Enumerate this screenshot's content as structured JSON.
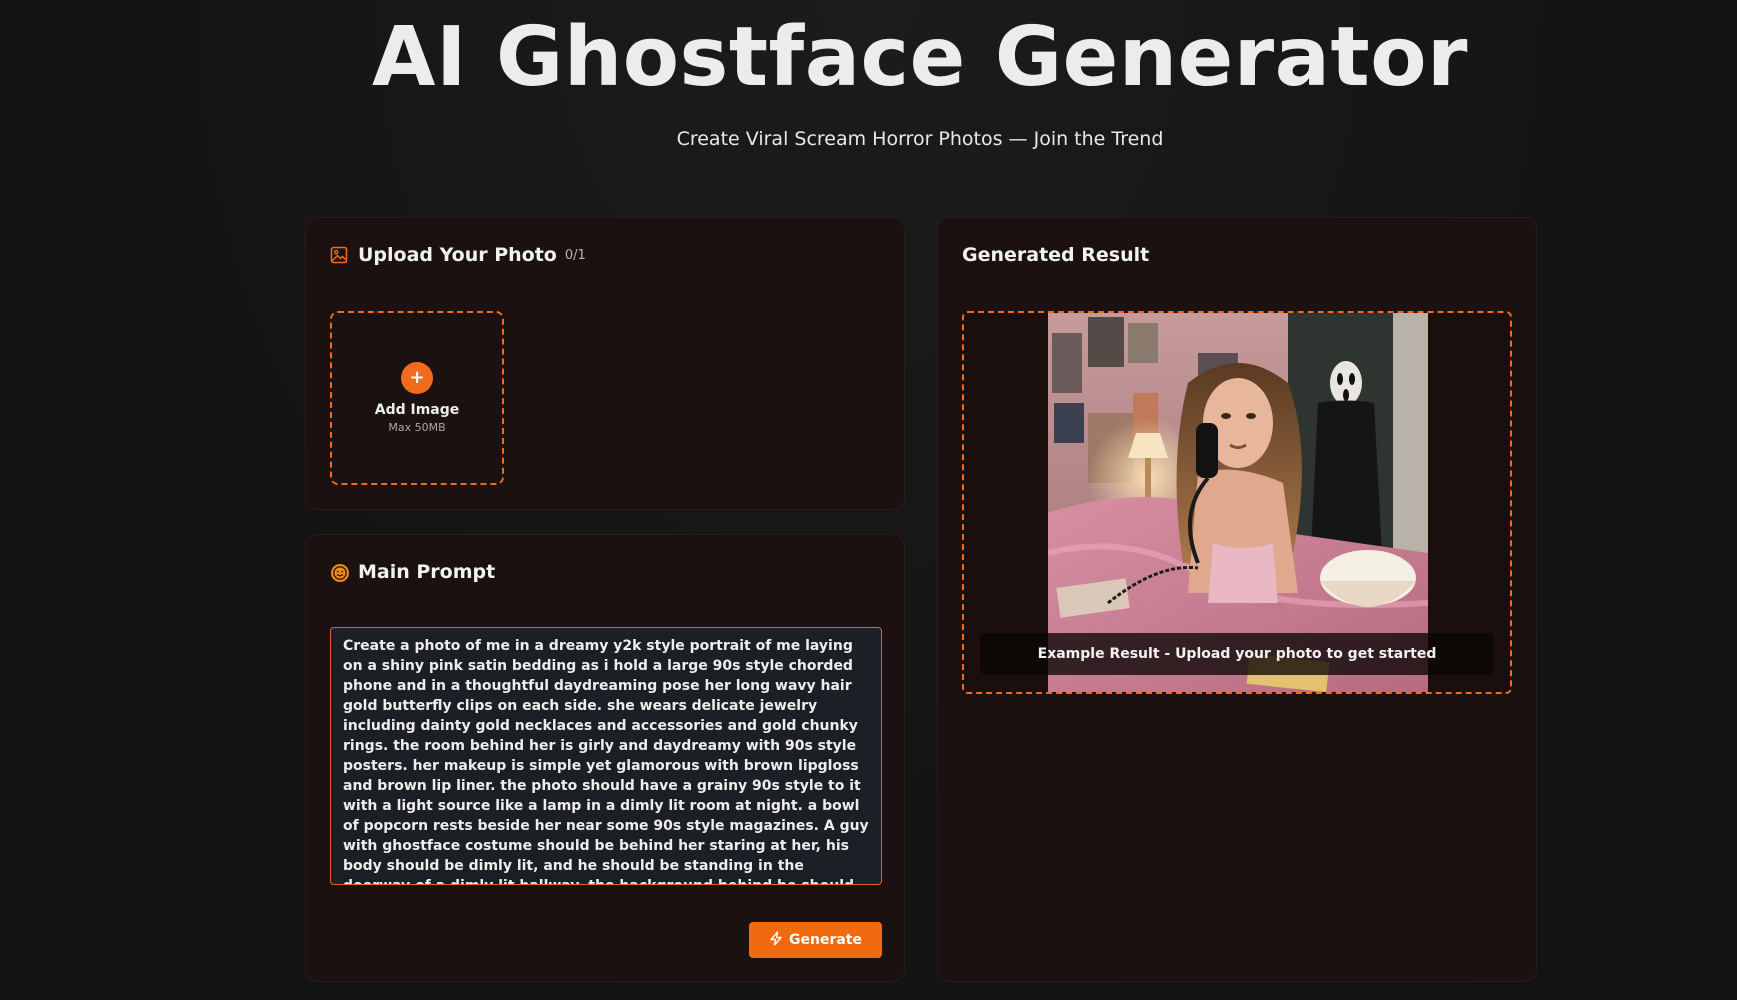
{
  "hero": {
    "title": "AI Ghostface Generator",
    "subtitle": "Create Viral Scream Horror Photos — Join the Trend"
  },
  "upload": {
    "title": "Upload Your Photo",
    "count": "0/1",
    "add_label": "Add Image",
    "max_size": "Max 50MB",
    "icon": "image-icon"
  },
  "prompt": {
    "title": "Main Prompt",
    "icon": "smiley-icon",
    "text": "Create a photo of me in a dreamy y2k style portrait of me laying on a shiny pink satin bedding as i hold a large 90s style chorded phone and in a thoughtful daydreaming pose her long wavy hair gold butterfly clips on each side. she wears delicate jewelry including dainty gold necklaces and accessories and gold chunky rings. the room behind her is girly and daydreamy with 90s style posters. her makeup is simple yet glamorous with brown lipgloss and brown lip liner. the photo should have a grainy 90s style to it with a light source like a lamp in a dimly lit room at night. a bowl of popcorn rests beside her near some 90s style magazines. A guy with ghostface costume should be behind her staring at her, his body should be dimly lit, and he should be standing in the doorway of a dimly lit hallway. the background behind he should be slightly dark and ominous.",
    "generate_label": "Generate",
    "generate_icon": "lightning-icon"
  },
  "result": {
    "title": "Generated Result",
    "caption": "Example Result - Upload your photo to get started"
  },
  "colors": {
    "accent": "#f26a1b",
    "background": "#141414",
    "card": "#1a1110"
  }
}
